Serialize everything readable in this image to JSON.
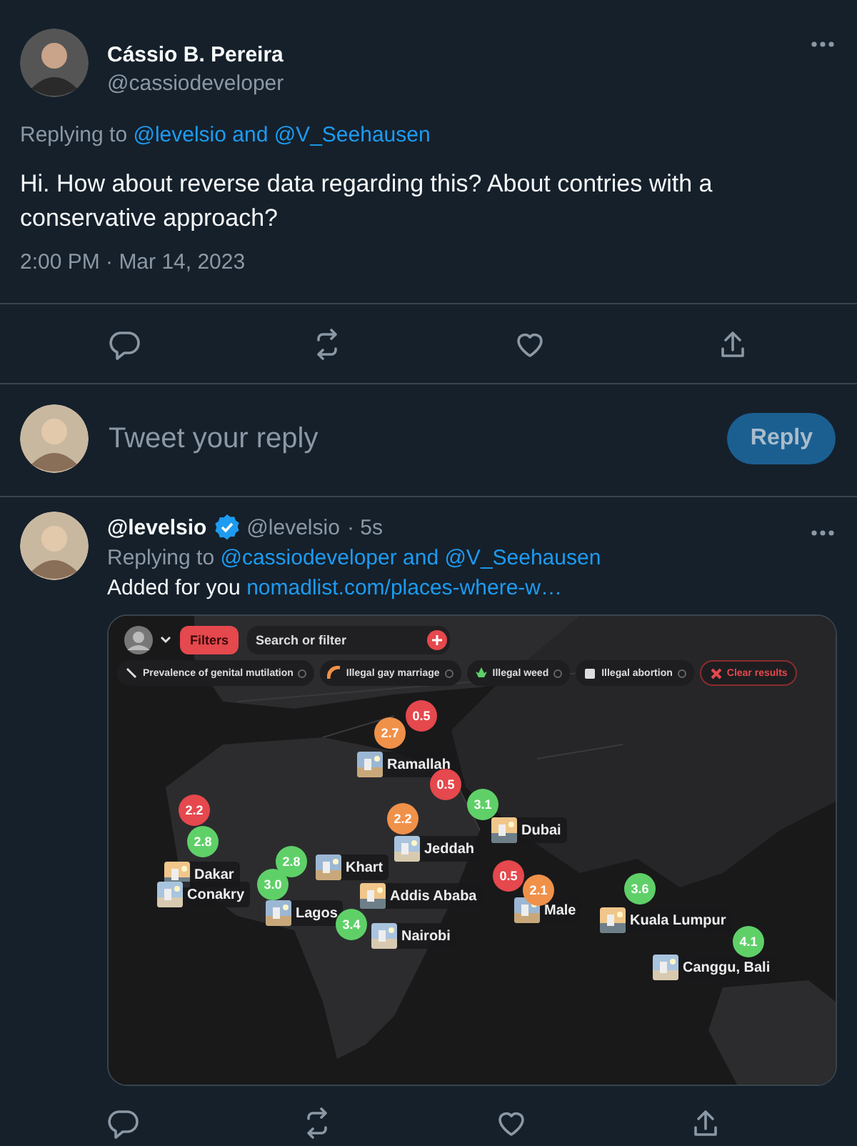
{
  "tweet": {
    "name": "Cássio B. Pereira",
    "handle": "@cassiodeveloper",
    "replying_prefix": "Replying to",
    "replying_to": "@levelsio and @V_Seehausen",
    "text": "Hi. How about reverse data regarding this? About contries with a conservative approach?",
    "timestamp": "2:00 PM · Mar 14, 2023"
  },
  "composer": {
    "placeholder": "Tweet your reply",
    "button": "Reply",
    "disabled": true
  },
  "reply": {
    "name": "@levelsio",
    "verified": true,
    "handle": "@levelsio",
    "time": "· 5s",
    "replying_prefix": "Replying to",
    "replying_to": "@cassiodeveloper and @V_Seehausen",
    "text": "Added for you",
    "link": "nomadlist.com/places-where-w…",
    "map_app": {
      "filters_button": "Filters",
      "search_placeholder": "Search or filter",
      "chips": [
        {
          "label": "Prevalence of genital mutilation",
          "kind": "filter"
        },
        {
          "label": "Illegal gay marriage",
          "kind": "filter"
        },
        {
          "label": "Illegal weed",
          "kind": "filter"
        },
        {
          "label": "Illegal abortion",
          "kind": "filter"
        },
        {
          "label": "Clear results",
          "kind": "clear"
        }
      ],
      "cities": [
        {
          "name": "Ramallah"
        },
        {
          "name": "Dubai"
        },
        {
          "name": "Jeddah"
        },
        {
          "name": "Khart"
        },
        {
          "name": "Dakar"
        },
        {
          "name": "Conakry"
        },
        {
          "name": "Lagos"
        },
        {
          "name": "Addis Ababa"
        },
        {
          "name": "Nairobi"
        },
        {
          "name": "Male"
        },
        {
          "name": "Kuala Lumpur"
        },
        {
          "name": "Canggu, Bali"
        }
      ],
      "markers": [
        {
          "rating": "0.5",
          "color": "#e5484d"
        },
        {
          "rating": "2.7",
          "color": "#f0914a"
        },
        {
          "rating": "0.5",
          "color": "#e5484d"
        },
        {
          "rating": "3.1",
          "color": "#5fd068"
        },
        {
          "rating": "2.2",
          "color": "#f0914a"
        },
        {
          "rating": "2.2",
          "color": "#e5484d"
        },
        {
          "rating": "2.8",
          "color": "#5fd068"
        },
        {
          "rating": "2.8",
          "color": "#5fd068"
        },
        {
          "rating": "3.0",
          "color": "#5fd068"
        },
        {
          "rating": "0.5",
          "color": "#e5484d"
        },
        {
          "rating": "3.4",
          "color": "#5fd068"
        },
        {
          "rating": "2.1",
          "color": "#f0914a"
        },
        {
          "rating": "3.6",
          "color": "#5fd068"
        },
        {
          "rating": "4.1",
          "color": "#5fd068"
        }
      ]
    }
  }
}
